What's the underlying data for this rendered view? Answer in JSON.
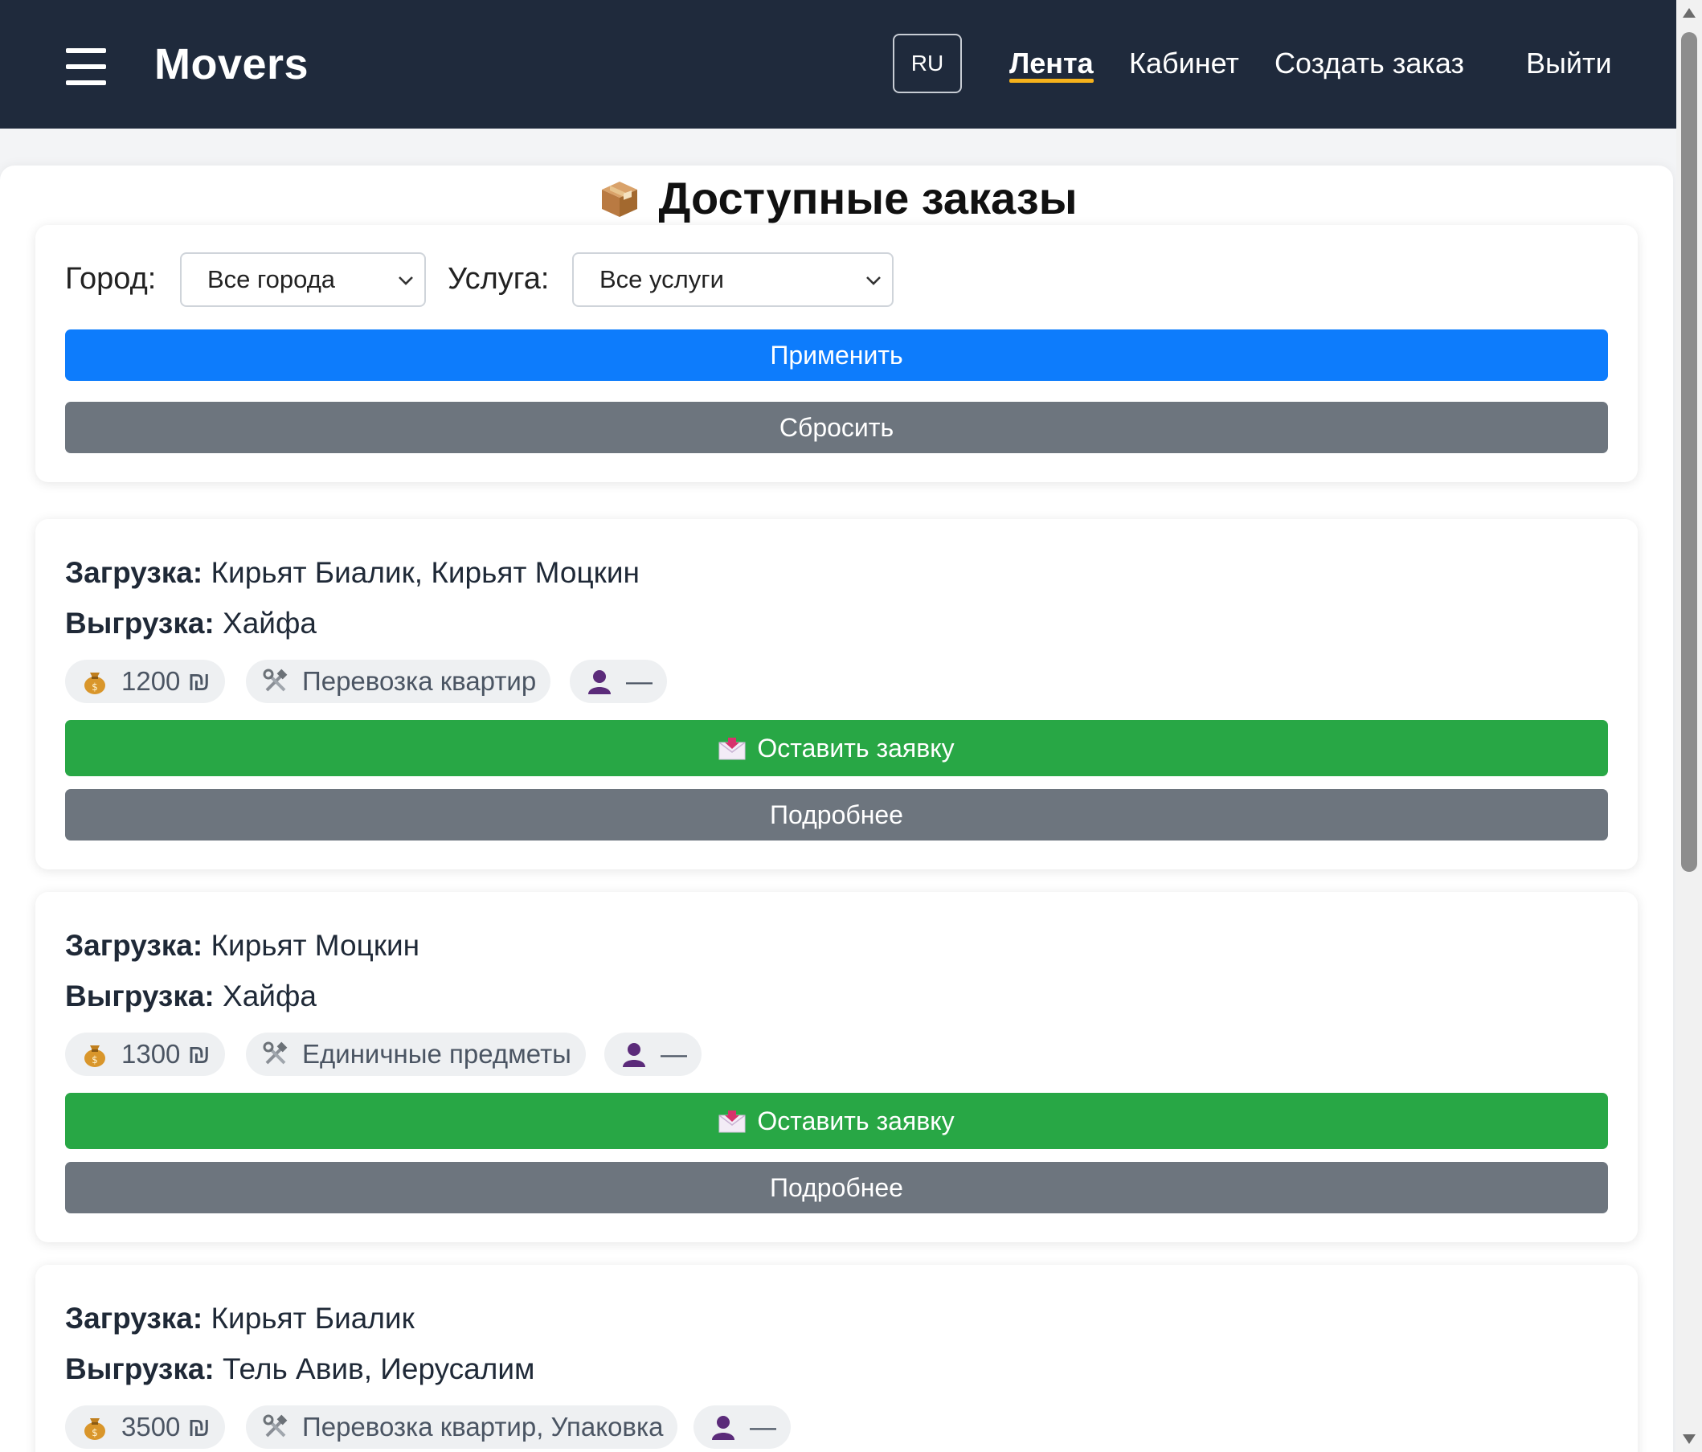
{
  "header": {
    "brand": "Movers",
    "lang": "RU",
    "nav": {
      "feed": "Лента",
      "cabinet": "Кабинет",
      "create_order": "Создать заказ",
      "logout": "Выйти"
    }
  },
  "page": {
    "title": "Доступные заказы"
  },
  "filters": {
    "city_label": "Город:",
    "city_value": "Все города",
    "service_label": "Услуга:",
    "service_value": "Все услуги",
    "apply": "Применить",
    "reset": "Сбросить"
  },
  "order_labels": {
    "loading": "Загрузка:",
    "unloading": "Выгрузка:",
    "apply_button": "Оставить заявку",
    "details_button": "Подробнее"
  },
  "orders": [
    {
      "loading": "Кирьят Биалик, Кирьят Моцкин",
      "unloading": "Хайфа",
      "price": "1200 ₪",
      "service": "Перевозка квартир",
      "user": "—"
    },
    {
      "loading": "Кирьят Моцкин",
      "unloading": "Хайфа",
      "price": "1300 ₪",
      "service": "Единичные предметы",
      "user": "—"
    },
    {
      "loading": "Кирьят Биалик",
      "unloading": "Тель Авив, Иерусалим",
      "price": "3500 ₪",
      "service": "Перевозка квартир, Упаковка",
      "user": "—"
    }
  ],
  "icons": {
    "menu": "hamburger-icon",
    "title": "package-icon",
    "price": "money-bag-icon",
    "service": "tools-icon",
    "user": "user-icon",
    "apply": "envelope-icon",
    "dropdown": "chevron-down-icon"
  },
  "colors": {
    "header_bg": "#1f2a3c",
    "active_underline": "#f6b21b",
    "primary": "#0d7cfc",
    "secondary": "#6d757e",
    "success": "#28a745"
  }
}
